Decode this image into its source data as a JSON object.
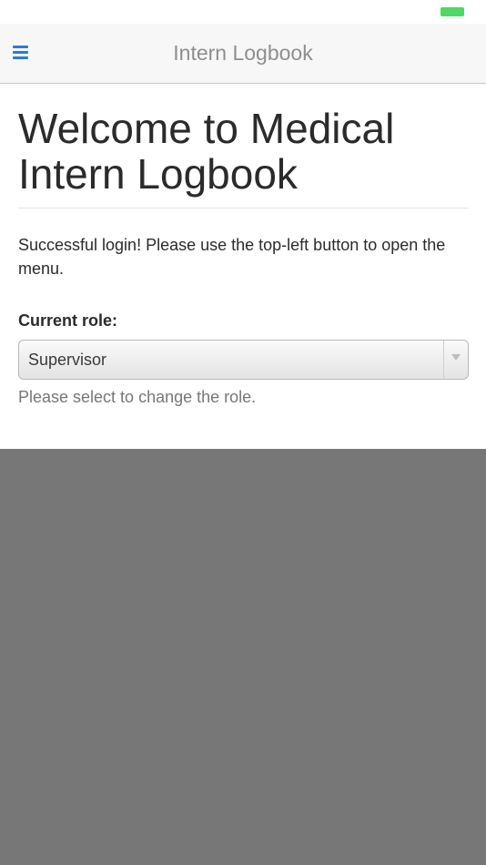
{
  "status_bar": {
    "battery_color": "#4cd964"
  },
  "header": {
    "menu_icon": "hamburger-menu-icon",
    "title": "Intern Logbook",
    "accent_color": "#2a7ae2"
  },
  "main": {
    "page_title": "Welcome to Medical Intern Logbook",
    "message": "Successful login! Please use the top-left button to open the menu.",
    "role_label": "Current role:",
    "role_select": {
      "selected": "Supervisor"
    },
    "help_text": "Please select to change the role."
  }
}
